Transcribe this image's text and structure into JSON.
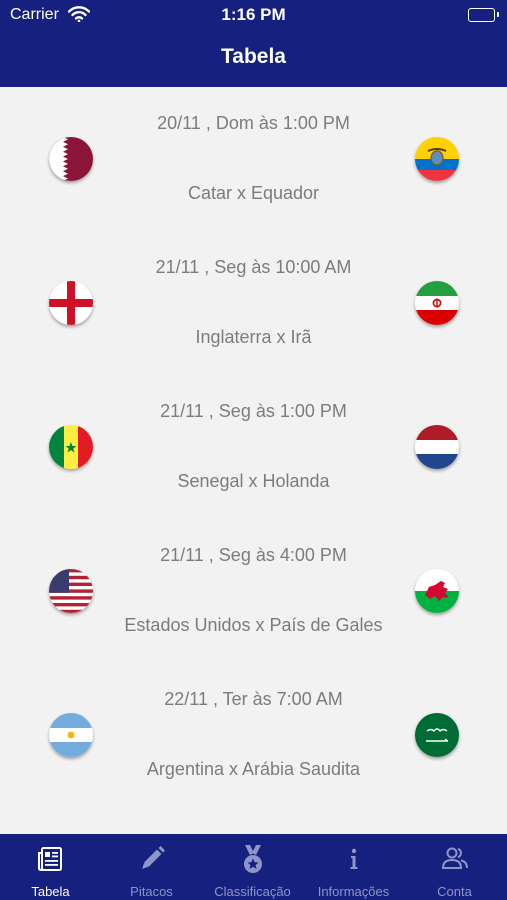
{
  "status_bar": {
    "carrier": "Carrier",
    "time": "1:16 PM"
  },
  "header": {
    "title": "Tabela"
  },
  "matches": [
    {
      "date": "20/11 , Dom às 1:00 PM",
      "teams": "Catar x Equador",
      "home_flag": "qatar-flag",
      "away_flag": "ecuador-flag"
    },
    {
      "date": "21/11 , Seg às 10:00 AM",
      "teams": "Inglaterra x Irã",
      "home_flag": "england-flag",
      "away_flag": "iran-flag"
    },
    {
      "date": "21/11 , Seg às 1:00 PM",
      "teams": "Senegal x Holanda",
      "home_flag": "senegal-flag",
      "away_flag": "netherlands-flag"
    },
    {
      "date": "21/11 , Seg às 4:00 PM",
      "teams": "Estados Unidos x País de Gales",
      "home_flag": "usa-flag",
      "away_flag": "wales-flag"
    },
    {
      "date": "22/11 , Ter às 7:00 AM",
      "teams": "Argentina x Arábia Saudita",
      "home_flag": "argentina-flag",
      "away_flag": "saudi-arabia-flag"
    }
  ],
  "tabbar": {
    "tabs": [
      {
        "label": "Tabela",
        "icon": "newspaper-icon",
        "active": true
      },
      {
        "label": "Pitacos",
        "icon": "pencil-icon",
        "active": false
      },
      {
        "label": "Classificação",
        "icon": "medal-icon",
        "active": false
      },
      {
        "label": "Informações",
        "icon": "info-icon",
        "active": false
      },
      {
        "label": "Conta",
        "icon": "people-icon",
        "active": false
      }
    ]
  },
  "colors": {
    "header": "#16207f",
    "background": "#f2f2f2",
    "text": "#7c7c7c",
    "tab_inactive": "#8e95c8"
  }
}
